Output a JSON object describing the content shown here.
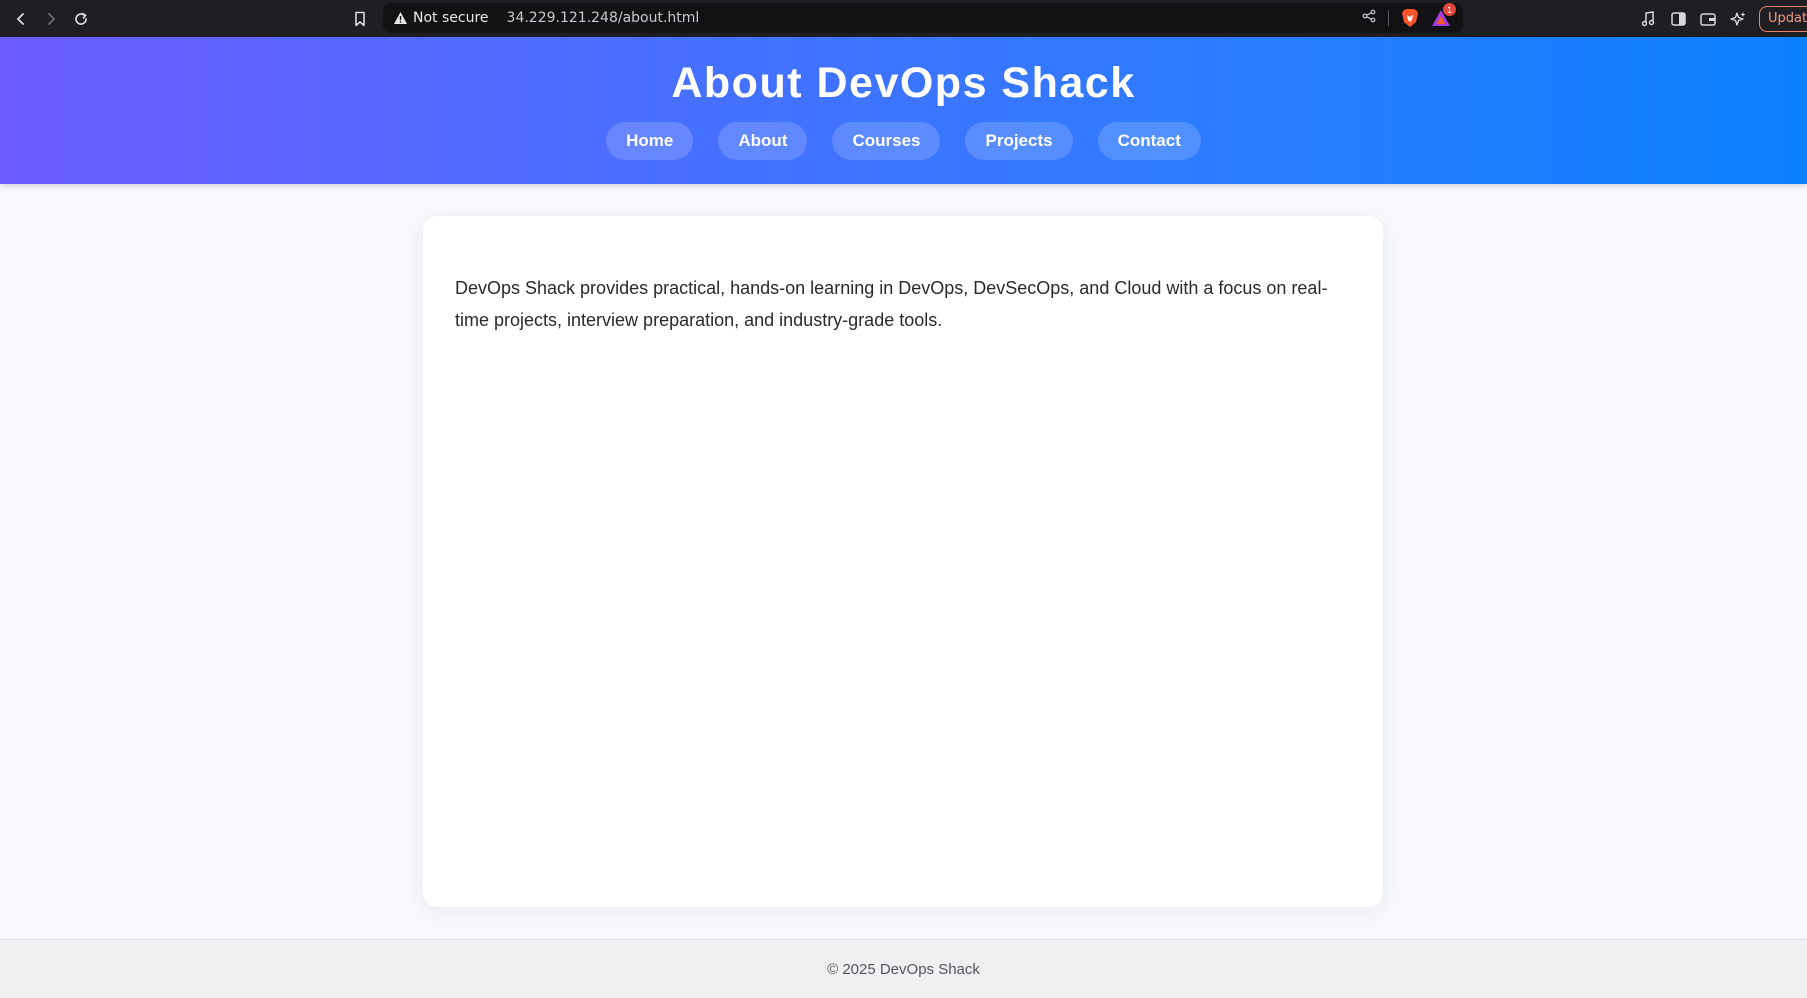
{
  "browser": {
    "security_label": "Not secure",
    "url": "34.229.121.248/about.html",
    "rewards_badge": "1",
    "update_label": "Update",
    "accent_update": "#e9826f"
  },
  "header": {
    "title": "About DevOps Shack",
    "nav": [
      "Home",
      "About",
      "Courses",
      "Projects",
      "Contact"
    ],
    "gradient_colors": [
      "#6b5cff",
      "#0a80ff"
    ]
  },
  "content": {
    "text": "DevOps Shack provides practical, hands-on learning in DevOps, DevSecOps, and Cloud with a focus on real-time projects, interview preparation, and industry-grade tools."
  },
  "footer": {
    "text": "© 2025 DevOps Shack"
  }
}
